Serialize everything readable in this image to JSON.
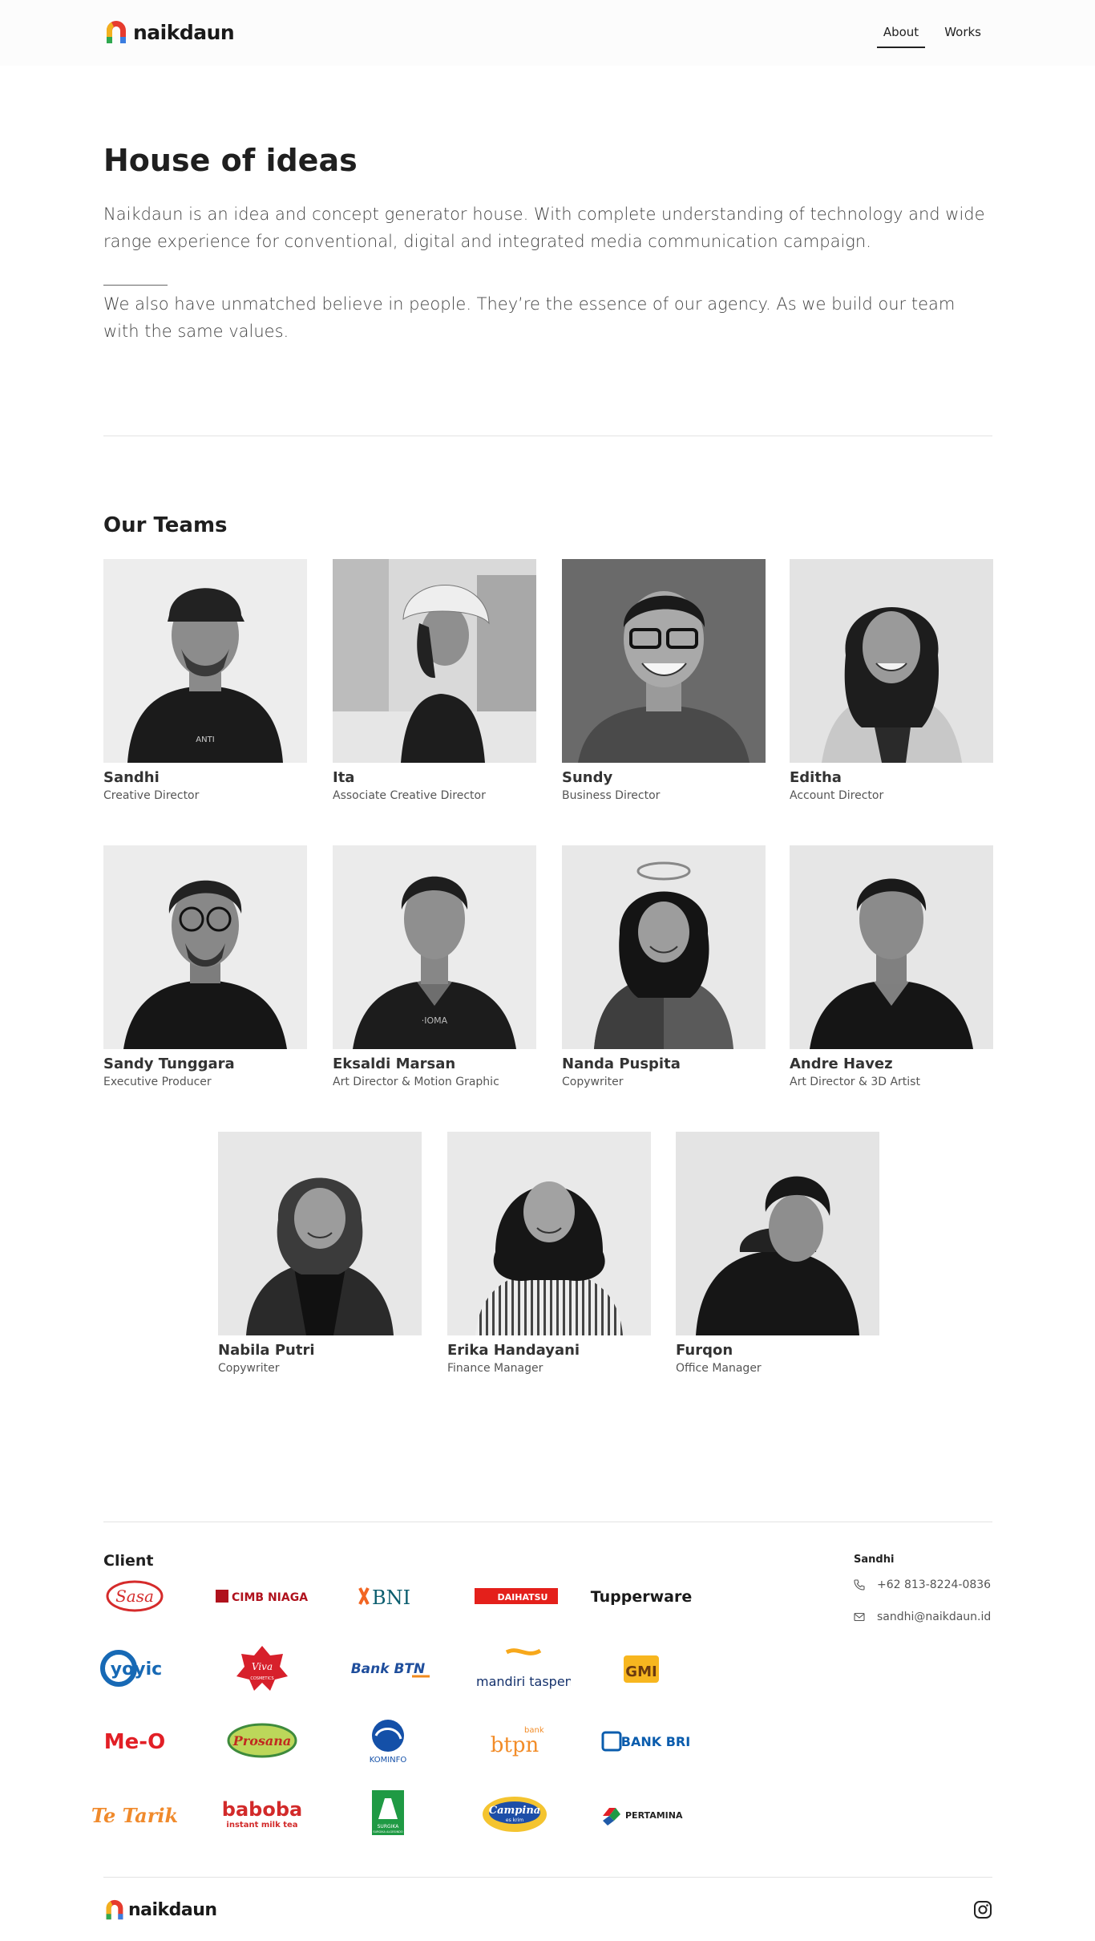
{
  "header": {
    "brand": "naikdaun",
    "nav": [
      {
        "label": "About",
        "active": true
      },
      {
        "label": "Works",
        "active": false
      }
    ]
  },
  "hero": {
    "title": "House of ideas",
    "p1": "Naikdaun is an idea and concept generator house. With complete understanding of technology and wide range experience for conventional, digital and integrated media communication campaign.",
    "p2": "We also have unmatched believe in people. They’re the essence of our agency. As we build our team with the same values."
  },
  "teams": {
    "title": "Our Teams",
    "members": [
      {
        "name": "Sandhi",
        "role": "Creative Director"
      },
      {
        "name": "Ita",
        "role": "Associate Creative Director"
      },
      {
        "name": "Sundy",
        "role": "Business Director"
      },
      {
        "name": "Editha",
        "role": "Account Director"
      },
      {
        "name": "Sandy Tunggara",
        "role": "Executive Producer"
      },
      {
        "name": "Eksaldi Marsan",
        "role": "Art Director & Motion Graphic"
      },
      {
        "name": "Nanda Puspita",
        "role": "Copywriter"
      },
      {
        "name": "Andre Havez",
        "role": "Art Director & 3D Artist"
      },
      {
        "name": "Nabila Putri",
        "role": "Copywriter"
      },
      {
        "name": "Erika Handayani",
        "role": "Finance Manager"
      },
      {
        "name": "Furqon",
        "role": "Office Manager"
      }
    ]
  },
  "client": {
    "title": "Client",
    "logos": [
      "Sasa",
      "CIMB NIAGA",
      "BNI",
      "DAIHATSU",
      "Tupperware",
      "yoyic",
      "Viva",
      "Bank BTN",
      "mandiri taspen",
      "GMI",
      "Me-O",
      "Prosana",
      "KOMINFO",
      "btpn",
      "BANK BRI",
      "Te Tarik",
      "baboba",
      "SURGIKA",
      "Campina",
      "PERTAMINA"
    ],
    "sub": {
      "viva": "COSMETICS",
      "baboba": "instant milk tea",
      "btpn_bank": "bank",
      "campina_sub": "es krim",
      "surgika": "SURGIKA ALGESINDO"
    }
  },
  "contact": {
    "name": "Sandhi",
    "phone": "+62 813-8224-0836",
    "email": "sandhi@naikdaun.id"
  },
  "footer": {
    "brand": "naikdaun"
  },
  "icons": [
    "phone-icon",
    "mail-icon",
    "instagram-icon"
  ],
  "colors": {
    "accent": "#222222",
    "divider": "#e3e3e3"
  }
}
